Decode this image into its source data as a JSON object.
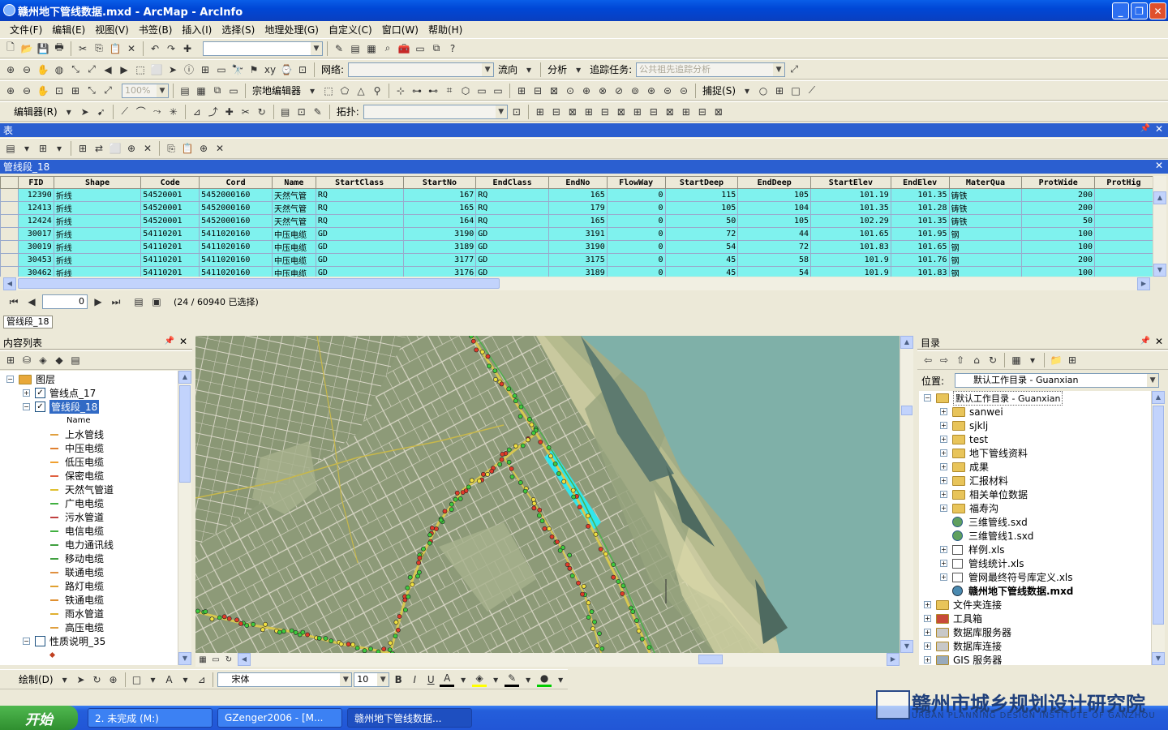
{
  "window": {
    "title": "赣州地下管线数据.mxd - ArcMap - ArcInfo"
  },
  "menu": [
    "文件(F)",
    "编辑(E)",
    "视图(V)",
    "书签(B)",
    "插入(I)",
    "选择(S)",
    "地理处理(G)",
    "自定义(C)",
    "窗口(W)",
    "帮助(H)"
  ],
  "toolbar": {
    "network_label": "网络:",
    "flow_label": "流向",
    "analysis_label": "分析",
    "trace_task_label": "追踪任务:",
    "trace_task_value": "公共祖先追踪分析",
    "zoom_value": "100%",
    "parcel_editor": "宗地编辑器",
    "snap_label": "捕捉(S)",
    "editor_label": "编辑器(R)",
    "topology_label": "拓扑:"
  },
  "table_window": {
    "title": "表",
    "layer_title": "管线段_18",
    "columns": [
      "FID",
      "Shape",
      "Code",
      "Cord",
      "Name",
      "StartClass",
      "StartNo",
      "EndClass",
      "EndNo",
      "FlowWay",
      "StartDeep",
      "EndDeep",
      "StartElev",
      "EndElev",
      "MaterQua",
      "ProtWide",
      "ProtHig"
    ],
    "rows": [
      [
        "12390",
        "折线",
        "54520001",
        "5452000160",
        "天然气管",
        "RQ",
        "167",
        "RQ",
        "165",
        "0",
        "115",
        "105",
        "101.19",
        "101.35",
        "铸铁",
        "200",
        ""
      ],
      [
        "12413",
        "折线",
        "54520001",
        "5452000160",
        "天然气管",
        "RQ",
        "165",
        "RQ",
        "179",
        "0",
        "105",
        "104",
        "101.35",
        "101.28",
        "铸铁",
        "200",
        ""
      ],
      [
        "12424",
        "折线",
        "54520001",
        "5452000160",
        "天然气管",
        "RQ",
        "164",
        "RQ",
        "165",
        "0",
        "50",
        "105",
        "102.29",
        "101.35",
        "铸铁",
        "50",
        ""
      ],
      [
        "30017",
        "折线",
        "54110201",
        "5411020160",
        "中压电缆",
        "GD",
        "3190",
        "GD",
        "3191",
        "0",
        "72",
        "44",
        "101.65",
        "101.95",
        "钢",
        "100",
        ""
      ],
      [
        "30019",
        "折线",
        "54110201",
        "5411020160",
        "中压电缆",
        "GD",
        "3189",
        "GD",
        "3190",
        "0",
        "54",
        "72",
        "101.83",
        "101.65",
        "钢",
        "100",
        ""
      ],
      [
        "30453",
        "折线",
        "54110201",
        "5411020160",
        "中压电缆",
        "GD",
        "3177",
        "GD",
        "3175",
        "0",
        "45",
        "58",
        "101.9",
        "101.76",
        "钢",
        "200",
        ""
      ],
      [
        "30462",
        "折线",
        "54110201",
        "5411020160",
        "中压电缆",
        "GD",
        "3176",
        "GD",
        "3189",
        "0",
        "45",
        "54",
        "101.9",
        "101.83",
        "钢",
        "100",
        ""
      ]
    ],
    "record_index": "0",
    "selection_status": "(24 / 60940 已选择)",
    "tab_label": "管线段_18"
  },
  "toc": {
    "title": "内容列表",
    "root": "图层",
    "layer1": "管线点_17",
    "layer2": "管线段_18",
    "field_name": "Name",
    "legend": [
      {
        "label": "上水管线",
        "color": "#e0a040"
      },
      {
        "label": "中压电缆",
        "color": "#e08030"
      },
      {
        "label": "低压电缆",
        "color": "#f0a030"
      },
      {
        "label": "保密电缆",
        "color": "#e06040"
      },
      {
        "label": "天然气管道",
        "color": "#e0c030"
      },
      {
        "label": "广电电缆",
        "color": "#40b040"
      },
      {
        "label": "污水管道",
        "color": "#c04040"
      },
      {
        "label": "电信电缆",
        "color": "#40b040"
      },
      {
        "label": "电力通讯线",
        "color": "#40a040"
      },
      {
        "label": "移动电缆",
        "color": "#40a040"
      },
      {
        "label": "联通电缆",
        "color": "#e09040"
      },
      {
        "label": "路灯电缆",
        "color": "#e0a030"
      },
      {
        "label": "铁通电缆",
        "color": "#e09030"
      },
      {
        "label": "雨水管道",
        "color": "#e0b030"
      },
      {
        "label": "高压电缆",
        "color": "#e0a040"
      }
    ],
    "layer3": "性质说明_35"
  },
  "catalog": {
    "title": "目录",
    "location_label": "位置:",
    "location_value": "默认工作目录 - Guanxian",
    "root": "默认工作目录 - Guanxian",
    "items": [
      "sanwei",
      "sjklj",
      "test",
      "地下管线资料",
      "成果",
      "汇报材料",
      "相关单位数据",
      "福寿沟",
      "三维管线.sxd",
      "三维管线1.sxd",
      "样例.xls",
      "管线统计.xls",
      "管网最终符号库定义.xls",
      "赣州地下管线数据.mxd"
    ],
    "top_level": [
      "文件夹连接",
      "工具箱",
      "数据库服务器",
      "数据库连接",
      "GIS 服务器"
    ]
  },
  "draw_toolbar": {
    "label": "绘制(D)",
    "font": "宋体",
    "size": "10"
  },
  "taskbar": {
    "start": "开始",
    "tasks": [
      "2. 未完成 (M:)",
      "GZenger2006 - [M...",
      "赣州地下管线数据..."
    ]
  },
  "watermark": {
    "cn": "赣州市城乡规划设计研究院",
    "en": "URBAN PLANNING DESIGN INSTITUTE OF GANZHOU"
  },
  "colors": {
    "title_blue": "#0a5ee8",
    "row_select": "#7ff2ee",
    "water": "#7fb0a8",
    "land": "#8a9a7a"
  }
}
